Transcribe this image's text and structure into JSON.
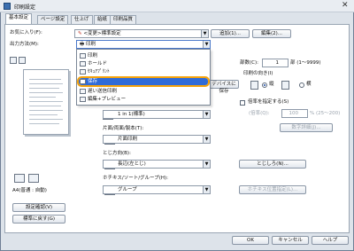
{
  "window": {
    "title": "印刷設定",
    "close_glyph": "✕"
  },
  "tabs": [
    {
      "label": "基本設定",
      "active": true
    },
    {
      "label": "ページ設定",
      "active": false
    },
    {
      "label": "仕上げ",
      "active": false
    },
    {
      "label": "給紙",
      "active": false
    },
    {
      "label": "印刷品質",
      "active": false
    }
  ],
  "favorites": {
    "label": "お気に入り(F):",
    "value": "<変更>標準設定",
    "add_button": "追加(1)...",
    "edit_button": "編集(2)..."
  },
  "output_method": {
    "label": "出力方法(M):",
    "value": "印刷",
    "options": [
      {
        "label": "印刷",
        "selected": false
      },
      {
        "label": "ホールド",
        "selected": false
      },
      {
        "label": "ｾｷｭｱﾌﾟﾘﾝﾄ",
        "selected": false
      },
      {
        "label": "保存",
        "selected": true
      },
      {
        "label": "遅い送信印刷",
        "selected": false
      },
      {
        "label": "編集+プレビュー",
        "selected": false
      }
    ]
  },
  "save_to_device_button": "デバイスに保存",
  "preview": {
    "paper_label": "A4(普通 : 自動)",
    "detail_button": "設定確認(V)",
    "reset_button": "標準に戻す(G)"
  },
  "color_mode": {
    "label": "",
    "value": "1 in 1(標準)"
  },
  "duplex": {
    "label": "片面/両面/製本(T):",
    "value": "片面印刷"
  },
  "binding": {
    "label": "とじ方向(B):",
    "value": "長辺(左とじ)",
    "button": "とじしろ(N)..."
  },
  "staple": {
    "label": "ホチキス/ソート/グループ(H):",
    "value": "グループ",
    "button": "ホチキス位置指定(L)..."
  },
  "copies": {
    "label": "部数(C):",
    "value": "1",
    "unit": "部 (1～9999)"
  },
  "orientation": {
    "label": "印刷の向き(I)",
    "portrait": "縦",
    "landscape": "横",
    "selected": "portrait"
  },
  "manual_scale": {
    "label": "倍率を指定する(S)",
    "field_label": "(倍率(Q):",
    "value": "100",
    "unit": "% (25～200)",
    "button": "数字詳細(J)..."
  },
  "footer": {
    "ok": "OK",
    "cancel": "キャンセル",
    "help": "ヘルプ"
  }
}
